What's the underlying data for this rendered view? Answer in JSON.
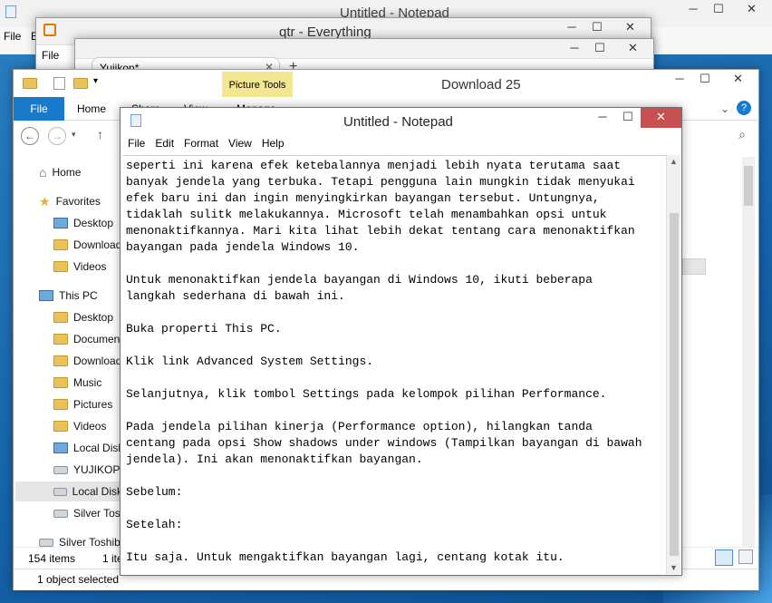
{
  "windows": {
    "back_notepad": {
      "title": "Untitled - Notepad",
      "menu_first": "File",
      "menu_second_partial": "E"
    },
    "everything": {
      "title": "qtr - Everything",
      "menu_first": "File",
      "tab_label": "Yujikon*"
    },
    "explorer": {
      "title": "Download 25",
      "contextual_tab": "Picture Tools",
      "ribbon_tabs": [
        "File",
        "Home",
        "Share",
        "View",
        "Manage"
      ],
      "nav": {
        "home": "Home",
        "favorites": "Favorites",
        "fav_items": [
          "Desktop",
          "Downloads",
          "Videos"
        ],
        "this_pc": "This PC",
        "pc_items": [
          "Desktop",
          "Documents",
          "Downloads",
          "Music",
          "Pictures",
          "Videos",
          "Local Disk",
          "YUJIKOPC",
          "Local Disk",
          "Silver Toshiba"
        ],
        "silver": "Silver Toshiba"
      },
      "status_items": "154 items",
      "status_selected_partial": "1 item",
      "status_selected": "1 object selected"
    },
    "notepad": {
      "title": "Untitled - Notepad",
      "menu": [
        "File",
        "Edit",
        "Format",
        "View",
        "Help"
      ],
      "lines": [
        "seperti ini karena efek ketebalannya menjadi lebih nyata terutama saat",
        "banyak jendela yang terbuka. Tetapi pengguna lain mungkin tidak menyukai",
        "efek baru ini dan ingin menyingkirkan bayangan tersebut. Untungnya,",
        "tidaklah sulitk melakukannya. Microsoft telah menambahkan opsi untuk",
        "menonaktifkannya. Mari kita lihat lebih dekat tentang cara menonaktifkan",
        "bayangan pada jendela Windows 10.",
        "",
        "Untuk menonaktifkan jendela bayangan di Windows 10, ikuti beberapa",
        "langkah sederhana di bawah ini.",
        "",
        "Buka properti This PC.",
        "",
        "Klik link Advanced System Settings.",
        "",
        "Selanjutnya, klik tombol Settings pada kelompok pilihan Performance.",
        "",
        "Pada jendela pilihan kinerja (Performance option), hilangkan tanda",
        "centang pada opsi Show shadows under windows (Tampilkan bayangan di bawah",
        "jendela). Ini akan menonaktifkan bayangan.",
        "",
        "Sebelum:",
        "",
        "Setelah:",
        "",
        "Itu saja. Untuk mengaktifkan bayangan lagi, centang kotak itu."
      ]
    }
  }
}
